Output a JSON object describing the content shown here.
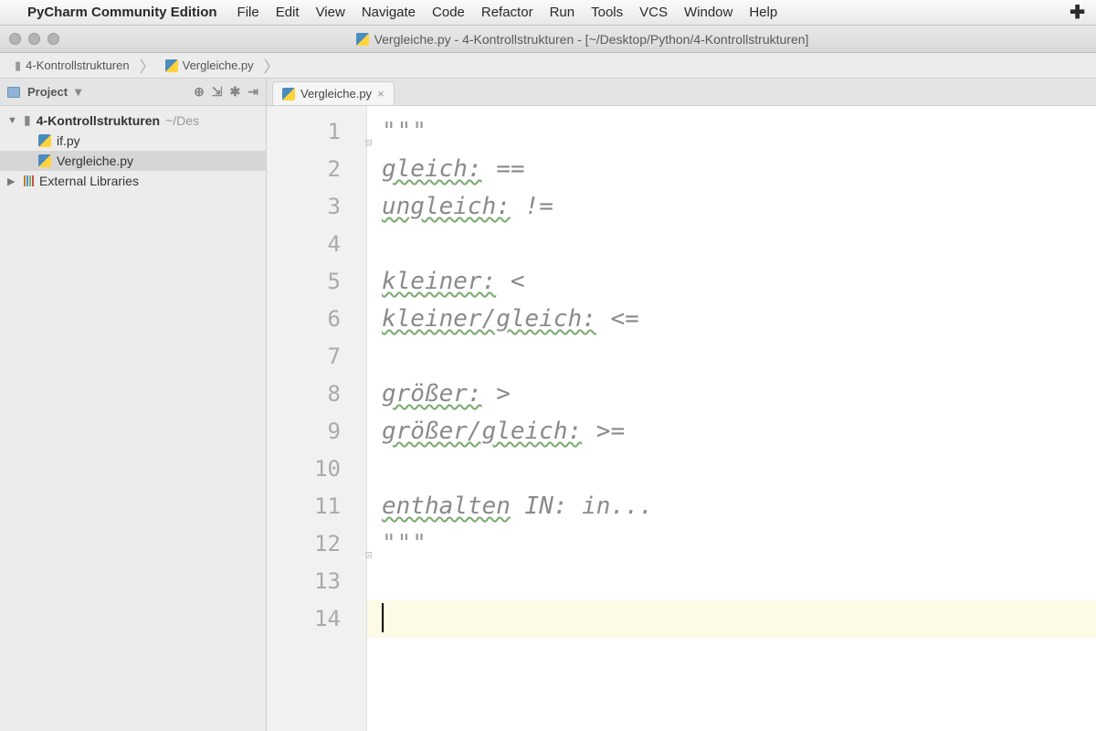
{
  "macmenu": {
    "app_name": "PyCharm Community Edition",
    "items": [
      "File",
      "Edit",
      "View",
      "Navigate",
      "Code",
      "Refactor",
      "Run",
      "Tools",
      "VCS",
      "Window",
      "Help"
    ]
  },
  "window": {
    "title": "Vergleiche.py - 4-Kontrollstrukturen - [~/Desktop/Python/4-Kontrollstrukturen]"
  },
  "breadcrumb": {
    "items": [
      "4-Kontrollstrukturen",
      "Vergleiche.py"
    ]
  },
  "toolwindow": {
    "title": "Project"
  },
  "tree": {
    "root": {
      "name": "4-Kontrollstrukturen",
      "path": "~/Des"
    },
    "files": [
      "if.py",
      "Vergleiche.py"
    ],
    "external": "External Libraries"
  },
  "tabs": {
    "active": "Vergleiche.py"
  },
  "editor": {
    "line_numbers": [
      "1",
      "2",
      "3",
      "4",
      "5",
      "6",
      "7",
      "8",
      "9",
      "10",
      "11",
      "12",
      "13",
      "14"
    ],
    "lines": [
      {
        "quote": "\"\"\""
      },
      {
        "sq": "gleich:",
        "rest": " =="
      },
      {
        "sq": "ungleich:",
        "rest": " !="
      },
      {
        "blank": true
      },
      {
        "sq": "kleiner:",
        "rest": " <"
      },
      {
        "sq": "kleiner/gleich:",
        "rest": " <="
      },
      {
        "blank": true
      },
      {
        "sq": "größer:",
        "rest": " >"
      },
      {
        "sq": "größer/gleich:",
        "rest": " >="
      },
      {
        "blank": true
      },
      {
        "sq": "enthalten",
        "rest": " IN: in..."
      },
      {
        "quote": "\"\"\""
      },
      {
        "blank": true
      },
      {
        "caret": true
      }
    ],
    "current_line_index": 13
  }
}
